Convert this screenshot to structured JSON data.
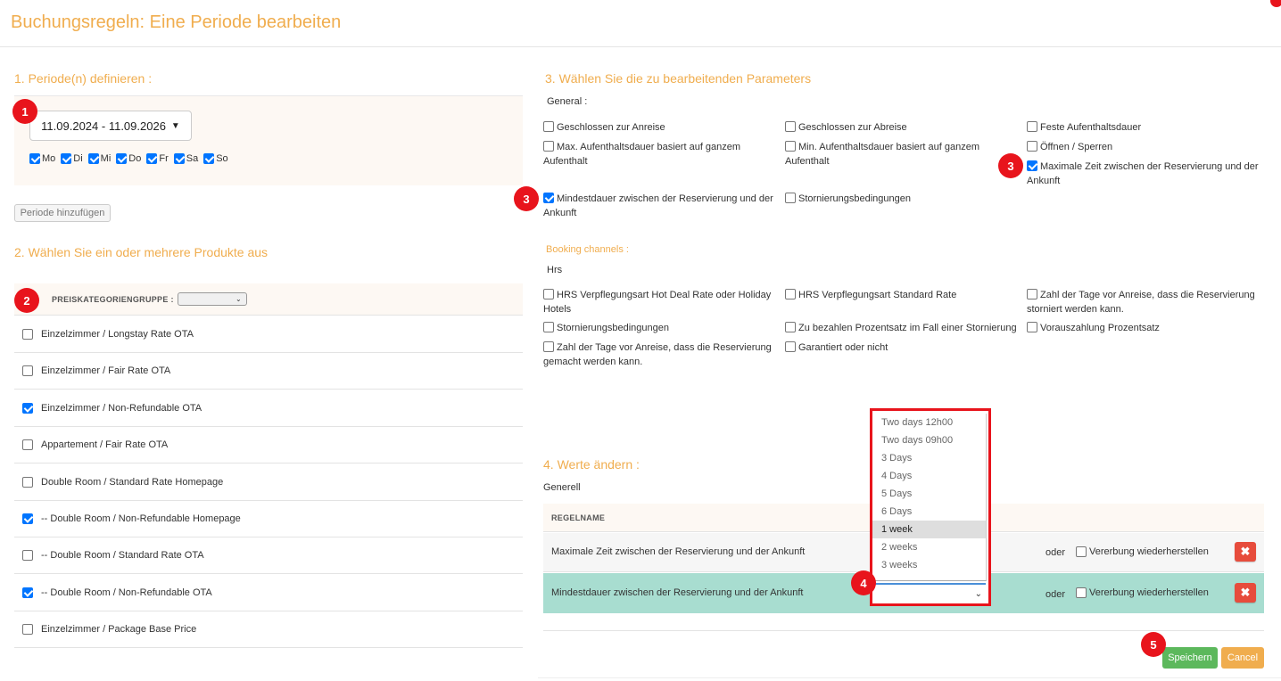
{
  "modal": {
    "title": "Buchungsregeln: Eine Periode bearbeiten"
  },
  "section1": {
    "title": "1. Periode(n) definieren :",
    "date_range": "11.09.2024 - 11.09.2026",
    "days": [
      {
        "label": "Mo",
        "checked": true
      },
      {
        "label": "Di",
        "checked": true
      },
      {
        "label": "Mi",
        "checked": true
      },
      {
        "label": "Do",
        "checked": true
      },
      {
        "label": "Fr",
        "checked": true
      },
      {
        "label": "Sa",
        "checked": true
      },
      {
        "label": "So",
        "checked": true
      }
    ],
    "add_period_label": "Periode hinzufügen"
  },
  "section2": {
    "title": "2. Wählen Sie ein oder mehrere Produkte aus",
    "group_label": "PREISKATEGORIENGRUPPE :",
    "products": [
      {
        "label": "Einzelzimmer / Longstay Rate OTA",
        "checked": false
      },
      {
        "label": "Einzelzimmer / Fair Rate OTA",
        "checked": false
      },
      {
        "label": "Einzelzimmer / Non-Refundable OTA",
        "checked": true
      },
      {
        "label": "Appartement / Fair Rate OTA",
        "checked": false
      },
      {
        "label": "Double Room / Standard Rate Homepage",
        "checked": false
      },
      {
        "label": "-- Double Room / Non-Refundable Homepage",
        "checked": true
      },
      {
        "label": "-- Double Room / Standard Rate OTA",
        "checked": false
      },
      {
        "label": "-- Double Room / Non-Refundable OTA",
        "checked": true
      },
      {
        "label": "Einzelzimmer / Package Base Price",
        "checked": false
      }
    ]
  },
  "section3": {
    "title": "3. Wählen Sie die zu bearbeitenden Parameters",
    "general_label": "General :",
    "general": [
      {
        "label": "Geschlossen zur Anreise",
        "checked": false
      },
      {
        "label": "Geschlossen zur Abreise",
        "checked": false
      },
      {
        "label": "Feste Aufenthaltsdauer",
        "checked": false
      },
      {
        "label": "Max. Aufenthaltsdauer basiert auf ganzem Aufenthalt",
        "checked": false
      },
      {
        "label": "Min. Aufenthaltsdauer basiert auf ganzem Aufenthalt",
        "checked": false
      },
      {
        "label": "Öffnen / Sperren",
        "checked": false
      },
      {
        "label": "Maximale Zeit zwischen der Reservierung und der Ankunft",
        "checked": true
      },
      {
        "label": "Mindestdauer zwischen der Reservierung und der Ankunft",
        "checked": true
      },
      {
        "label": "Stornierungsbedingungen",
        "checked": false
      }
    ],
    "channels_label": "Booking channels :",
    "channel_name": "Hrs",
    "channels": [
      {
        "label": "HRS Verpflegungsart Hot Deal Rate oder Holiday Hotels",
        "checked": false
      },
      {
        "label": "HRS Verpflegungsart Standard Rate",
        "checked": false
      },
      {
        "label": "Zahl der Tage vor Anreise, dass die Reservierung storniert werden kann.",
        "checked": false
      },
      {
        "label": "Stornierungsbedingungen",
        "checked": false
      },
      {
        "label": "Zu bezahlen Prozentsatz im Fall einer Stornierung",
        "checked": false
      },
      {
        "label": "Vorauszahlung Prozentsatz",
        "checked": false
      },
      {
        "label": "Zahl der Tage vor Anreise, dass die Reservierung gemacht werden kann.",
        "checked": false
      },
      {
        "label": "Garantiert oder nicht",
        "checked": false
      }
    ]
  },
  "section4": {
    "title": "4. Werte ändern :",
    "subtitle": "Generell",
    "col_header": "REGELNAME",
    "rows": [
      {
        "name": "Maximale Zeit zwischen der Reservierung und der Ankunft",
        "oder": "oder",
        "inherit": "Vererbung wiederherstellen"
      },
      {
        "name": "Mindestdauer zwischen der Reservierung und der Ankunft",
        "oder": "oder",
        "inherit": "Vererbung wiederherstellen"
      }
    ],
    "dropdown_options": [
      "Two days 12h00",
      "Two days 09h00",
      "3 Days",
      "4 Days",
      "5 Days",
      "6 Days",
      "1 week",
      "2 weeks",
      "3 weeks"
    ],
    "dropdown_selected": "1 week"
  },
  "footer": {
    "save_label": "Speichern",
    "cancel_label": "Cancel"
  },
  "annotations": [
    "1",
    "2",
    "3",
    "3",
    "4",
    "5"
  ],
  "colors": {
    "accent": "#f0ad4e",
    "badge": "#e8141c",
    "save": "#5cb85c",
    "cancel": "#f0ad4e",
    "delete": "#e74c3c",
    "highlight_row": "#a8ddd0"
  }
}
